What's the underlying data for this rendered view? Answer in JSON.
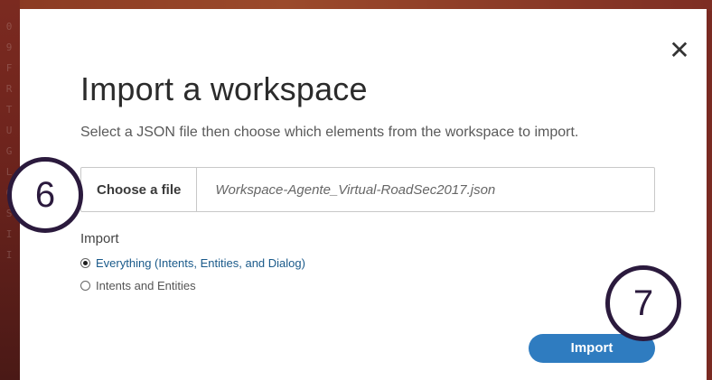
{
  "background": {
    "edge_letters": [
      "0",
      "",
      "9",
      "F",
      "R",
      "",
      "",
      "T",
      "U",
      "G",
      "L",
      "O",
      "S",
      "I",
      "I"
    ]
  },
  "dialog": {
    "close_glyph": "✕",
    "title": "Import a workspace",
    "subtitle": "Select a JSON file then choose which elements from the workspace to import.",
    "file_picker": {
      "button_label": "Choose a file",
      "file_name": "Workspace-Agente_Virtual-RoadSec2017.json"
    },
    "import_section": {
      "label": "Import",
      "options": [
        {
          "label": "Everything (Intents, Entities, and Dialog)",
          "selected": true
        },
        {
          "label": "Intents and Entities",
          "selected": false
        }
      ]
    },
    "import_button": "Import"
  },
  "annotations": {
    "step_a": "6",
    "step_b": "7"
  },
  "colors": {
    "accent": "#2f7cc0",
    "annotation_ring": "#2b1a3d",
    "background": "#7a2a22"
  }
}
